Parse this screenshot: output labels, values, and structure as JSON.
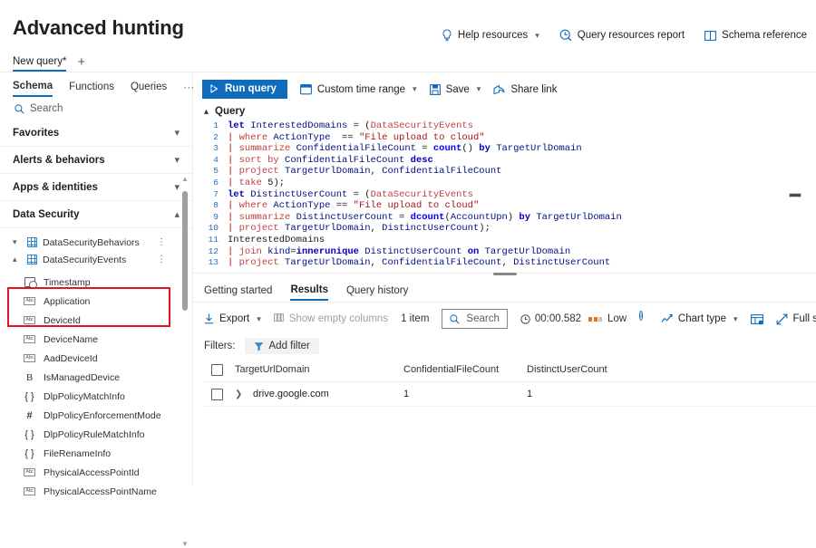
{
  "header": {
    "title": "Advanced hunting",
    "actions": [
      {
        "label": "Help resources",
        "icon": "lightbulb-icon",
        "chevron": "⌄"
      },
      {
        "label": "Query resources report",
        "icon": "report-icon"
      },
      {
        "label": "Schema reference",
        "icon": "book-icon"
      }
    ]
  },
  "query_tabs": {
    "tab_label": "New query*",
    "add_label": "+"
  },
  "sidebar": {
    "tabs": [
      {
        "label": "Schema",
        "active": true
      },
      {
        "label": "Functions",
        "active": false
      },
      {
        "label": "Queries",
        "active": false
      }
    ],
    "overflow": "···",
    "collapse_icon": "chevron-left-icon",
    "search_placeholder": "Search",
    "groups": [
      {
        "label": "Favorites",
        "expanded": false
      },
      {
        "label": "Alerts & behaviors",
        "expanded": false
      },
      {
        "label": "Apps & identities",
        "expanded": false
      },
      {
        "label": "Data Security",
        "expanded": true
      }
    ],
    "tables": [
      {
        "label": "DataSecurityBehaviors",
        "expanded": false
      },
      {
        "label": "DataSecurityEvents",
        "expanded": true
      }
    ],
    "fields": [
      {
        "name": "Timestamp",
        "type": "datetime"
      },
      {
        "name": "Application",
        "type": "string"
      },
      {
        "name": "DeviceId",
        "type": "string"
      },
      {
        "name": "DeviceName",
        "type": "string"
      },
      {
        "name": "AadDeviceId",
        "type": "string"
      },
      {
        "name": "IsManagedDevice",
        "type": "bool"
      },
      {
        "name": "DlpPolicyMatchInfo",
        "type": "dynamic"
      },
      {
        "name": "DlpPolicyEnforcementMode",
        "type": "int"
      },
      {
        "name": "DlpPolicyRuleMatchInfo",
        "type": "dynamic"
      },
      {
        "name": "FileRenameInfo",
        "type": "dynamic"
      },
      {
        "name": "PhysicalAccessPointId",
        "type": "string"
      },
      {
        "name": "PhysicalAccessPointName",
        "type": "string"
      }
    ],
    "highlight_color": "#e81123"
  },
  "query_toolbar": {
    "run_label": "Run query",
    "time_range_label": "Custom time range",
    "save_label": "Save",
    "share_label": "Share link",
    "section_label": "Query",
    "accent_color": "#0f6cbd"
  },
  "editor": {
    "lines": [
      {
        "n": "1",
        "tokens": [
          {
            "t": "let ",
            "c": "kw"
          },
          {
            "t": "InterestedDomains ",
            "c": "ctext"
          },
          {
            "t": "= ",
            "c": "eq"
          },
          {
            "t": "(",
            "c": "plain"
          },
          {
            "t": "DataSecurityEvents",
            "c": "cmd"
          }
        ]
      },
      {
        "n": "2",
        "tokens": [
          {
            "t": "| ",
            "c": "op-pipe"
          },
          {
            "t": "where ",
            "c": "cmd"
          },
          {
            "t": "ActionType  ",
            "c": "col"
          },
          {
            "t": "== ",
            "c": "eq"
          },
          {
            "t": "\"File upload to cloud\"",
            "c": "str"
          }
        ]
      },
      {
        "n": "3",
        "tokens": [
          {
            "t": "| ",
            "c": "op-pipe"
          },
          {
            "t": "summarize ",
            "c": "cmd"
          },
          {
            "t": "ConfidentialFileCount ",
            "c": "ctext"
          },
          {
            "t": "= ",
            "c": "eq"
          },
          {
            "t": "count",
            "c": "fn"
          },
          {
            "t": "() ",
            "c": "plain"
          },
          {
            "t": "by ",
            "c": "kw"
          },
          {
            "t": "TargetUrlDomain",
            "c": "col"
          }
        ]
      },
      {
        "n": "4",
        "tokens": [
          {
            "t": "| ",
            "c": "op-pipe"
          },
          {
            "t": "sort ",
            "c": "cmd"
          },
          {
            "t": "by ",
            "c": "cmd"
          },
          {
            "t": "ConfidentialFileCount ",
            "c": "col"
          },
          {
            "t": "desc",
            "c": "kw"
          }
        ]
      },
      {
        "n": "5",
        "tokens": [
          {
            "t": "| ",
            "c": "op-pipe"
          },
          {
            "t": "project ",
            "c": "cmd"
          },
          {
            "t": "TargetUrlDomain",
            "c": "col"
          },
          {
            "t": ", ",
            "c": "plain"
          },
          {
            "t": "ConfidentialFileCount",
            "c": "col"
          }
        ]
      },
      {
        "n": "6",
        "tokens": [
          {
            "t": "| ",
            "c": "op-pipe"
          },
          {
            "t": "take ",
            "c": "cmd"
          },
          {
            "t": "5",
            "c": "plain"
          },
          {
            "t": ");",
            "c": "plain"
          }
        ]
      },
      {
        "n": "7",
        "tokens": [
          {
            "t": "let ",
            "c": "kw"
          },
          {
            "t": "DistinctUserCount ",
            "c": "ctext"
          },
          {
            "t": "= ",
            "c": "eq"
          },
          {
            "t": "(",
            "c": "plain"
          },
          {
            "t": "DataSecurityEvents",
            "c": "cmd"
          }
        ]
      },
      {
        "n": "8",
        "tokens": [
          {
            "t": "| ",
            "c": "op-pipe"
          },
          {
            "t": "where ",
            "c": "cmd"
          },
          {
            "t": "ActionType ",
            "c": "col"
          },
          {
            "t": "== ",
            "c": "eq"
          },
          {
            "t": "\"File upload to cloud\"",
            "c": "str"
          }
        ]
      },
      {
        "n": "9",
        "tokens": [
          {
            "t": "| ",
            "c": "op-pipe"
          },
          {
            "t": "summarize ",
            "c": "cmd"
          },
          {
            "t": "DistinctUserCount ",
            "c": "ctext"
          },
          {
            "t": "= ",
            "c": "eq"
          },
          {
            "t": "dcount",
            "c": "fn"
          },
          {
            "t": "(",
            "c": "plain"
          },
          {
            "t": "AccountUpn",
            "c": "col"
          },
          {
            "t": ") ",
            "c": "plain"
          },
          {
            "t": "by ",
            "c": "kw"
          },
          {
            "t": "TargetUrlDomain",
            "c": "col"
          }
        ]
      },
      {
        "n": "10",
        "tokens": [
          {
            "t": "| ",
            "c": "op-pipe"
          },
          {
            "t": "project ",
            "c": "cmd"
          },
          {
            "t": "TargetUrlDomain",
            "c": "col"
          },
          {
            "t": ", ",
            "c": "plain"
          },
          {
            "t": "DistinctUserCount",
            "c": "col"
          },
          {
            "t": ");",
            "c": "plain"
          }
        ]
      },
      {
        "n": "11",
        "tokens": [
          {
            "t": "InterestedDomains",
            "c": "plain"
          }
        ]
      },
      {
        "n": "12",
        "tokens": [
          {
            "t": "| ",
            "c": "op-pipe"
          },
          {
            "t": "join ",
            "c": "cmd"
          },
          {
            "t": "kind",
            "c": "col"
          },
          {
            "t": "=",
            "c": "eq"
          },
          {
            "t": "innerunique ",
            "c": "kw"
          },
          {
            "t": "DistinctUserCount ",
            "c": "col"
          },
          {
            "t": "on ",
            "c": "kw"
          },
          {
            "t": "TargetUrlDomain",
            "c": "col"
          }
        ]
      },
      {
        "n": "13",
        "tokens": [
          {
            "t": "| ",
            "c": "op-pipe"
          },
          {
            "t": "project ",
            "c": "cmd"
          },
          {
            "t": "TargetUrlDomain",
            "c": "col"
          },
          {
            "t": ", ",
            "c": "plain"
          },
          {
            "t": "ConfidentialFileCount",
            "c": "col"
          },
          {
            "t": ", ",
            "c": "plain"
          },
          {
            "t": "DistinctUserCount",
            "c": "col"
          }
        ]
      }
    ]
  },
  "results": {
    "tabs": [
      {
        "label": "Getting started",
        "active": false
      },
      {
        "label": "Results",
        "active": true
      },
      {
        "label": "Query history",
        "active": false
      }
    ],
    "export_label": "Export",
    "show_empty_label": "Show empty columns",
    "item_count": "1 item",
    "search_placeholder": "Search",
    "duration": "00:00.582",
    "complexity": "Low",
    "complexity_color": "#e8751a",
    "chart_type_label": "Chart type",
    "full_screen_label": "Full screen",
    "filters_label": "Filters:",
    "add_filter_label": "Add filter",
    "columns": [
      "TargetUrlDomain",
      "ConfidentialFileCount",
      "DistinctUserCount"
    ],
    "rows": [
      {
        "TargetUrlDomain": "drive.google.com",
        "ConfidentialFileCount": "1",
        "DistinctUserCount": "1"
      }
    ]
  }
}
